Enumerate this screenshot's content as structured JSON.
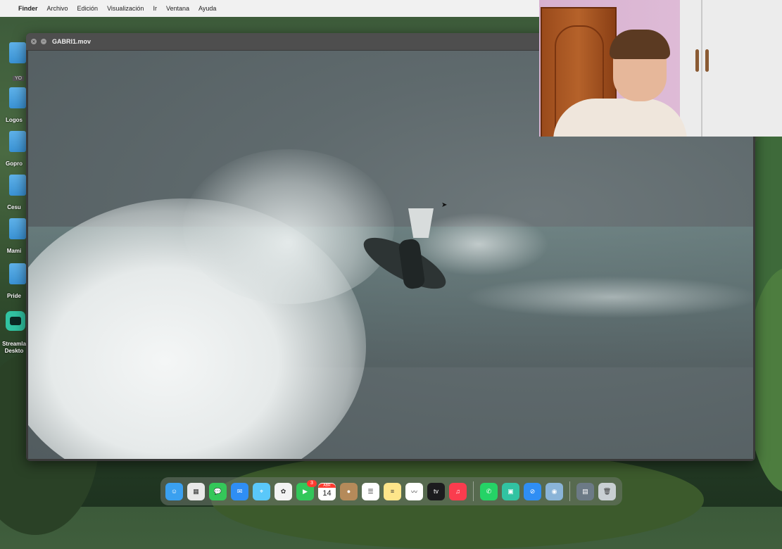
{
  "menubar": {
    "apple": "",
    "items": [
      "Finder",
      "Archivo",
      "Edición",
      "Visualización",
      "Ir",
      "Ventana",
      "Ayuda"
    ]
  },
  "desktop": {
    "tag": "YO",
    "icons": [
      {
        "label": "Logos",
        "type": "folder"
      },
      {
        "label": "Gopro",
        "type": "folder"
      },
      {
        "label": "Cesu",
        "type": "folder"
      },
      {
        "label": "Mami",
        "type": "folder"
      },
      {
        "label": "Pride",
        "type": "folder"
      },
      {
        "label": "Streamla Deskto",
        "type": "app"
      }
    ]
  },
  "video_window": {
    "title": "GABRI1.mov"
  },
  "dock": {
    "items": [
      {
        "name": "finder-icon",
        "color": "#3aa0f0",
        "glyph": "☺"
      },
      {
        "name": "launchpad-icon",
        "color": "#e8e8e8",
        "glyph": "▦"
      },
      {
        "name": "messages-icon",
        "color": "#34c759",
        "glyph": "💬"
      },
      {
        "name": "mail-icon",
        "color": "#2f8ef4",
        "glyph": "✉"
      },
      {
        "name": "maps-icon",
        "color": "#5ac8fa",
        "glyph": "⌖"
      },
      {
        "name": "photos-icon",
        "color": "#f3f3f3",
        "glyph": "✿"
      },
      {
        "name": "facetime-icon",
        "color": "#32c75a",
        "glyph": "▶",
        "badge": "3"
      },
      {
        "name": "calendar-icon",
        "color": "#ffffff",
        "month": "ABR",
        "day": "14"
      },
      {
        "name": "contacts-icon",
        "color": "#b58a5a",
        "glyph": "●"
      },
      {
        "name": "reminders-icon",
        "color": "#ffffff",
        "glyph": "☰"
      },
      {
        "name": "notes-icon",
        "color": "#fde58a",
        "glyph": "≡"
      },
      {
        "name": "freeform-icon",
        "color": "#ffffff",
        "glyph": "〰"
      },
      {
        "name": "appletv-icon",
        "color": "#1c1c1e",
        "glyph": "tv"
      },
      {
        "name": "music-icon",
        "color": "#fa3c4e",
        "glyph": "♫"
      },
      {
        "name": "whatsapp-icon",
        "color": "#25d366",
        "glyph": "✆"
      },
      {
        "name": "streamlabs-icon",
        "color": "#31c3a2",
        "glyph": "▣"
      },
      {
        "name": "safari-icon",
        "color": "#2f8ef4",
        "glyph": "⊘"
      },
      {
        "name": "quicktime-icon",
        "color": "#8ab4d8",
        "glyph": "◉"
      }
    ],
    "right": [
      {
        "name": "downloads-stack-icon",
        "color": "#6c7a86",
        "glyph": "▤"
      },
      {
        "name": "trash-icon",
        "color": "#c9cfd3",
        "glyph": "🗑"
      }
    ]
  }
}
